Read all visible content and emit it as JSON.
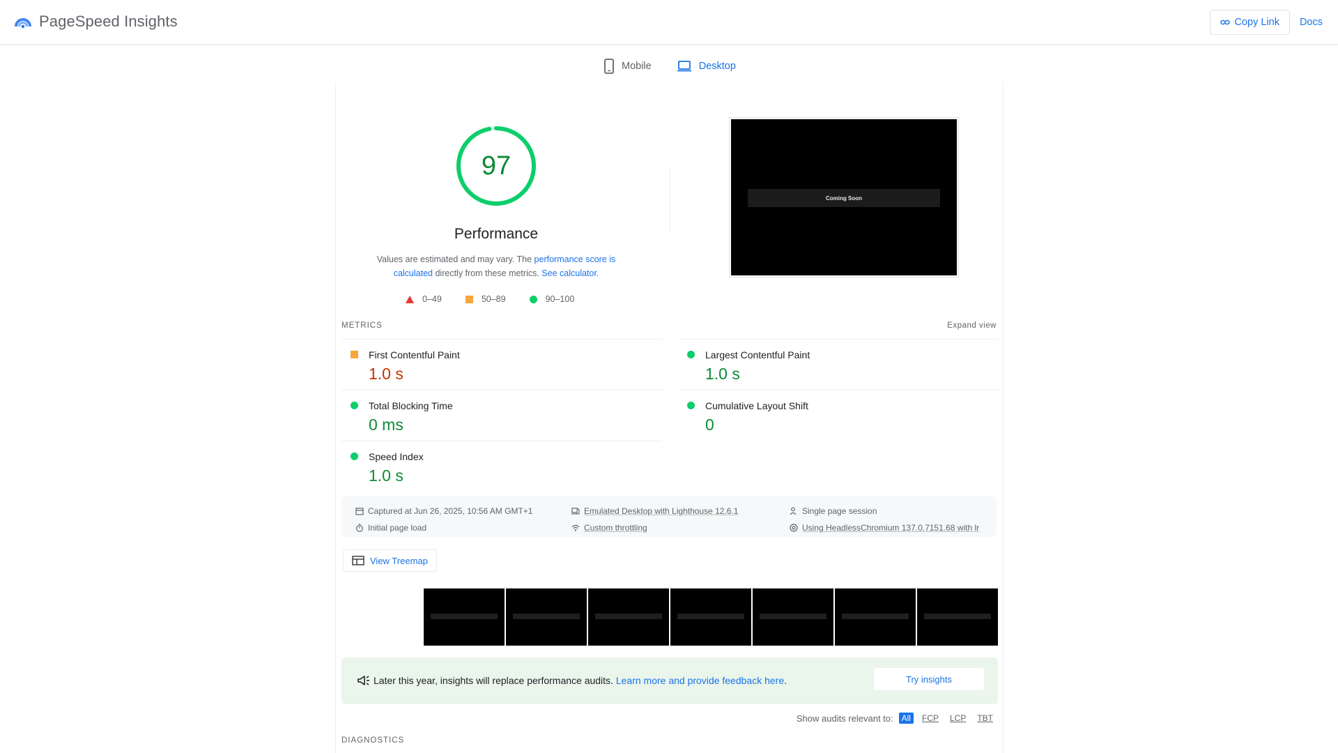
{
  "header": {
    "brand_name": "PageSpeed Insights",
    "copy_link_label": "Copy Link",
    "docs_label": "Docs"
  },
  "tabs": [
    {
      "label": "Mobile",
      "icon": "smartphone-icon",
      "active": false
    },
    {
      "label": "Desktop",
      "icon": "laptop-icon",
      "active": true
    }
  ],
  "performance": {
    "score": "97",
    "score_fraction": 0.97,
    "title": "Performance",
    "desc_prefix": "Values are estimated and may vary. The ",
    "desc_link1": "performance score is calculated",
    "desc_middle": " directly from these metrics. ",
    "desc_link2": "See calculator.",
    "legend": [
      {
        "range": "0–49",
        "shape": "triangle",
        "color": "#e53935"
      },
      {
        "range": "50–89",
        "shape": "square",
        "color": "#f4a83a"
      },
      {
        "range": "90–100",
        "shape": "circle",
        "color": "#0cce6b"
      }
    ]
  },
  "screenshot": {
    "text": "Coming Soon"
  },
  "metrics": {
    "heading": "METRICS",
    "expand_label": "Expand view",
    "items": [
      {
        "name": "First Contentful Paint",
        "value": "1.0 s",
        "status": "average"
      },
      {
        "name": "Largest Contentful Paint",
        "value": "1.0 s",
        "status": "good"
      },
      {
        "name": "Total Blocking Time",
        "value": "0 ms",
        "status": "good"
      },
      {
        "name": "Cumulative Layout Shift",
        "value": "0",
        "status": "good"
      },
      {
        "name": "Speed Index",
        "value": "1.0 s",
        "status": "good"
      }
    ]
  },
  "info": {
    "captured": "Captured at Jun 26, 2025, 10:56 AM GMT+1",
    "initial_load": "Initial page load",
    "emulated": "Emulated Desktop with Lighthouse 12.6.1",
    "throttling": "Custom throttling",
    "session": "Single page session",
    "browser": "Using HeadlessChromium 137.0.7151.68 with lr"
  },
  "treemap_label": "View Treemap",
  "banner": {
    "text": "Later this year, insights will replace performance audits. ",
    "link": "Learn more and provide feedback here",
    "text_end": ".",
    "button": "Try insights"
  },
  "filters": {
    "label": "Show audits relevant to:",
    "chips": [
      "All",
      "FCP",
      "LCP",
      "TBT"
    ]
  },
  "diagnostics_heading": "DIAGNOSTICS",
  "colors": {
    "accent": "#1a73e8",
    "good": "#0cce6b",
    "average": "#f4a83a",
    "poor": "#e53935"
  }
}
